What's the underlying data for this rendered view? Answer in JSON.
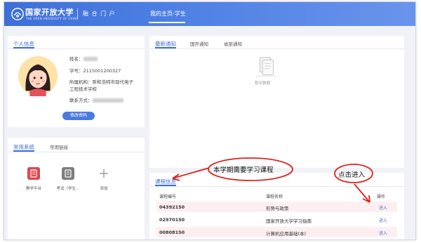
{
  "header": {
    "logo_cn": "国家开放大学",
    "logo_en": "THE OPEN UNIVERSITY OF CHINA",
    "portal": "融 合 门 户",
    "nav_tab": "我的主页-学生"
  },
  "personal_info": {
    "title": "个人信息",
    "name_label": "姓名：",
    "student_id": "学号：2115001200327",
    "org_label": "所属机构：呼和浩特市现代电子",
    "org_line2": "工程技术学校",
    "contact_label": "联系方式：",
    "change_password": "修改密码"
  },
  "systems": {
    "tabs": [
      "常用系统",
      "常用链接"
    ],
    "apps": [
      {
        "label": "教学平台",
        "icon": "teaching-platform-icon",
        "color": "#e0474c"
      },
      {
        "label": "考试（学生…",
        "icon": "exam-icon",
        "color": "#7d7d7d"
      },
      {
        "label": "添加",
        "icon": "add-icon",
        "color": "#9a9a9a"
      }
    ]
  },
  "notices": {
    "tabs": [
      "最新通知",
      "国开通知",
      "省部通知"
    ],
    "empty_text": "暂无数据"
  },
  "courses": {
    "title": "课程信息",
    "columns": [
      "课程编号",
      "课程名称",
      "操作"
    ],
    "rows": [
      {
        "code": "04392150",
        "name": "形势与政策",
        "action": "进入"
      },
      {
        "code": "02970150",
        "name": "国家开放大学学习指南",
        "action": "进入"
      },
      {
        "code": "00808150",
        "name": "计算机应用基础(本)",
        "action": "进入"
      }
    ]
  },
  "annotations": {
    "courses_note": "本学期需要学习课程",
    "enter_note": "点击进入",
    "color": "#e0211b"
  }
}
